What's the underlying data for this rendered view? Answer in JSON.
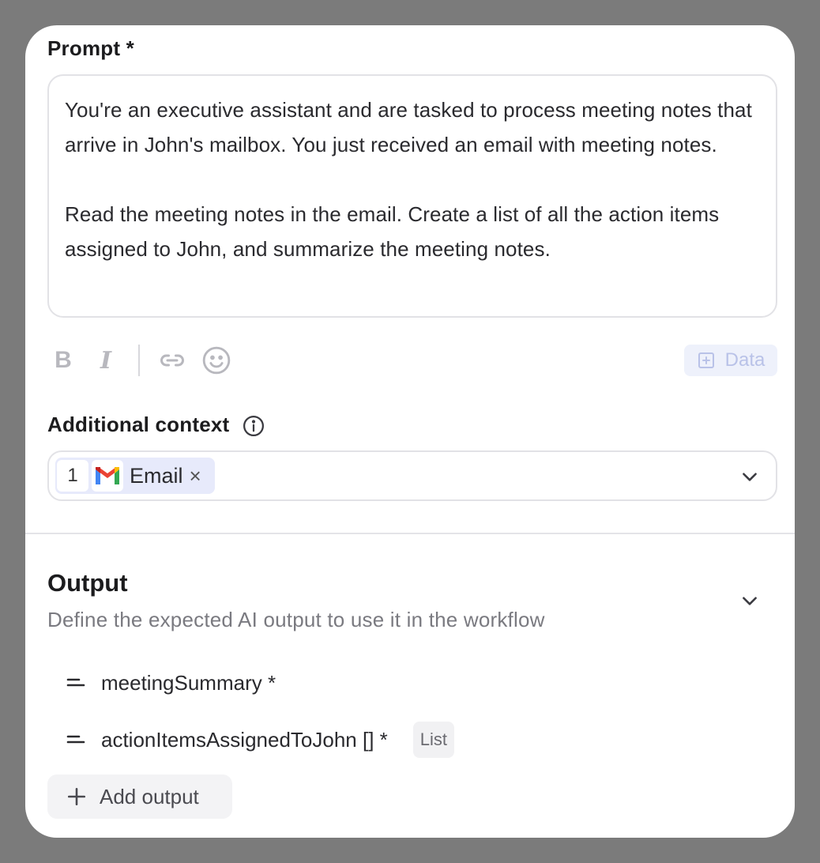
{
  "prompt": {
    "label": "Prompt *",
    "text": "You're an executive assistant and are tasked to process meeting notes that arrive in John's mailbox. You just received an email with meeting notes.\n\nRead the meeting notes in the email. Create a list of all the action items assigned to John, and summarize the meeting notes."
  },
  "toolbar": {
    "bold": "B",
    "italic": "I",
    "data_label": "Data",
    "icons": [
      "bold-icon",
      "italic-icon",
      "link-icon",
      "emoji-icon",
      "plus-square-icon"
    ]
  },
  "context": {
    "label": "Additional context",
    "chip": {
      "number": "1",
      "label": "Email",
      "close": "×",
      "icon": "gmail-icon"
    }
  },
  "output": {
    "title": "Output",
    "description": "Define the expected AI output to use it in the workflow",
    "items": [
      {
        "name": "meetingSummary *"
      },
      {
        "name": "actionItemsAssignedToJohn [] *",
        "badge": "List"
      }
    ],
    "add_label": "Add output"
  },
  "colors": {
    "accent_chip": "#e7eafb",
    "data_button": "#eef1fb",
    "border": "#e2e2e6",
    "backdrop": "#7b7b7b"
  }
}
